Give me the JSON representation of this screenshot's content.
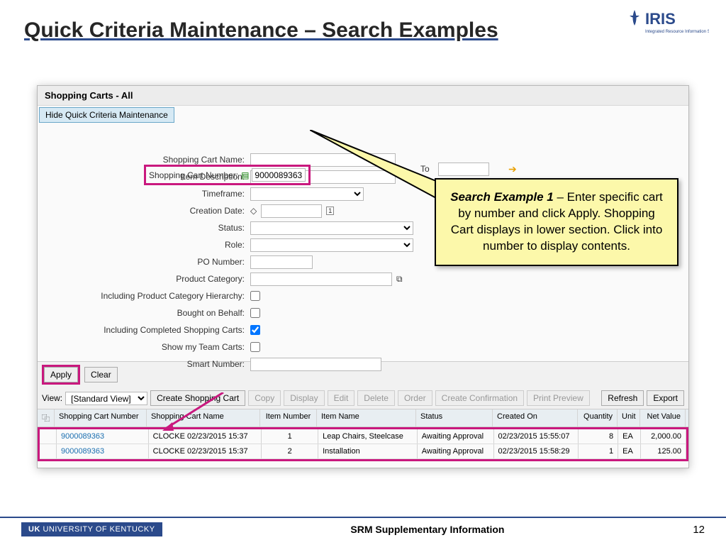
{
  "title": "Quick Criteria Maintenance – Search Examples",
  "logo_text": "IRIS",
  "logo_sub": "Integrated Resource Information System",
  "panel_title": "Shopping Carts - All",
  "hide_btn": "Hide Quick Criteria Maintenance",
  "form": {
    "cart_num_label": "Shopping Cart Number:",
    "cart_num_value": "9000089363",
    "to_label": "To",
    "cart_name_label": "Shopping Cart Name:",
    "item_desc_label": "Item Description:",
    "timeframe_label": "Timeframe:",
    "creation_date_label": "Creation Date:",
    "status_label": "Status:",
    "role_label": "Role:",
    "po_number_label": "PO Number:",
    "product_cat_label": "Product Category:",
    "incl_hier_label": "Including Product Category Hierarchy:",
    "bought_label": "Bought on Behalf:",
    "incl_complete_label": "Including Completed Shopping Carts:",
    "team_label": "Show my Team Carts:",
    "smart_label": "Smart Number:"
  },
  "callout": {
    "title": "Search Example 1",
    "body": "Enter specific cart by number and click Apply. Shopping Cart displays in lower section. Click into number to display contents."
  },
  "buttons": {
    "apply": "Apply",
    "clear": "Clear",
    "view": "View:",
    "std_view": "[Standard View]",
    "create": "Create Shopping Cart",
    "copy": "Copy",
    "display": "Display",
    "edit": "Edit",
    "delete": "Delete",
    "order": "Order",
    "confirm": "Create Confirmation",
    "print": "Print Preview",
    "refresh": "Refresh",
    "export": "Export"
  },
  "columns": {
    "num": "Shopping Cart Number",
    "name": "Shopping Cart Name",
    "inum": "Item Number",
    "iname": "Item Name",
    "status": "Status",
    "created": "Created On",
    "qty": "Quantity",
    "unit": "Unit",
    "net": "Net Value"
  },
  "rows": [
    {
      "num": "9000089363",
      "name": "CLOCKE 02/23/2015 15:37",
      "inum": "1",
      "iname": "Leap Chairs, Steelcase",
      "status": "Awaiting Approval",
      "created": "02/23/2015 15:55:07",
      "qty": "8",
      "unit": "EA",
      "net": "2,000.00"
    },
    {
      "num": "9000089363",
      "name": "CLOCKE 02/23/2015 15:37",
      "inum": "2",
      "iname": "Installation",
      "status": "Awaiting Approval",
      "created": "02/23/2015 15:58:29",
      "qty": "1",
      "unit": "EA",
      "net": "125.00"
    }
  ],
  "footer": {
    "uk": "UNIVERSITY OF KENTUCKY",
    "center": "SRM Supplementary Information",
    "page": "12"
  }
}
